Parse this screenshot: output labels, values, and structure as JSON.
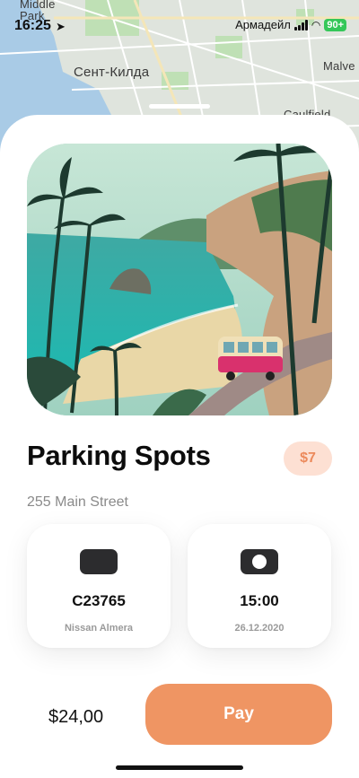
{
  "status_bar": {
    "time": "16:25",
    "location_arrow": "location-arrow-icon",
    "carrier_overlay": "Армадейл",
    "battery": "90+"
  },
  "map": {
    "labels": {
      "top_left": "Middle\nPark",
      "st_kilda": "Сент-Килда",
      "malvern": "Malve",
      "caulfield": "Caulfield"
    }
  },
  "parking": {
    "title": "Parking Spots",
    "price_badge": "$7",
    "address": "255 Main Street",
    "cards": [
      {
        "icon": "car-plate-icon",
        "value": "C23765",
        "caption": "Nissan Almera"
      },
      {
        "icon": "clock-icon",
        "value": "15:00",
        "caption": "26.12.2020"
      }
    ]
  },
  "footer": {
    "total": "$24,00",
    "pay_label": "Pay"
  },
  "colors": {
    "accent": "#ef9563",
    "badge_bg": "#fde0d3",
    "badge_text": "#ec8a5c"
  }
}
